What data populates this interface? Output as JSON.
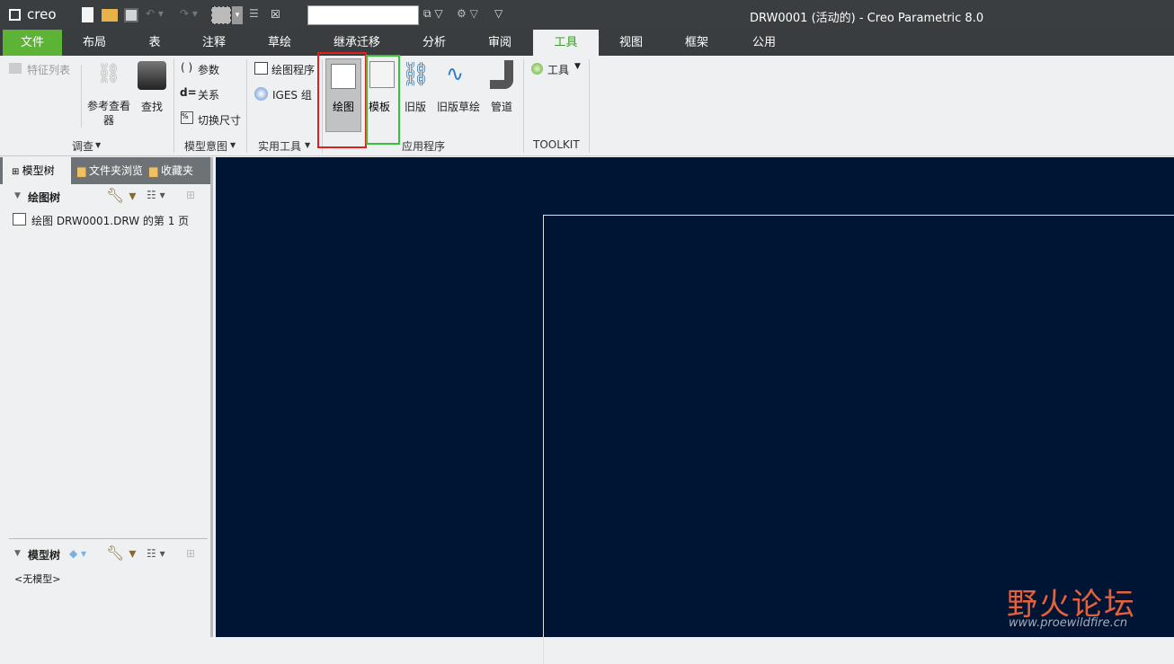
{
  "titlebar": {
    "logo": "creo",
    "title": "DRW0001 (活动的) - Creo Parametric 8.0",
    "search_value": ""
  },
  "tabs": [
    "文件",
    "布局",
    "表",
    "注释",
    "草绘",
    "继承迁移",
    "分析",
    "审阅",
    "工具",
    "视图",
    "框架",
    "公用"
  ],
  "ribbon": {
    "investigate": {
      "feature_list": "特征列表",
      "ref_viewer": "参考查看器",
      "find": "查找",
      "label": "调查"
    },
    "model_intent": {
      "params": "参数",
      "relations": "关系",
      "switch_dims": "切换尺寸",
      "label": "模型意图"
    },
    "utilities": {
      "drawing_program": "绘图程序",
      "iges": "IGES 组",
      "label": "实用工具"
    },
    "applications": {
      "drawing": "绘图",
      "template": "模板",
      "legacy": "旧版",
      "legacy_sketch": "旧版草绘",
      "piping": "管道",
      "label": "应用程序"
    },
    "toolkit": {
      "tools": "工具",
      "label": "TOOLKIT"
    }
  },
  "left_panel": {
    "tabs": [
      "模型树",
      "文件夹浏览器",
      "收藏夹"
    ],
    "drawing_tree_label": "绘图树",
    "drawing_tree_item": "绘图 DRW0001.DRW 的第 1 页",
    "model_tree_label": "模型树",
    "model_tree_empty": "<无模型>"
  },
  "watermark": {
    "name": "野火论坛",
    "url": "www.proewildfire.cn"
  },
  "colors": {
    "file_tab": "#5cb336",
    "canvas": "#001433",
    "highlight_red": "#e02020",
    "highlight_green": "#35c235"
  }
}
